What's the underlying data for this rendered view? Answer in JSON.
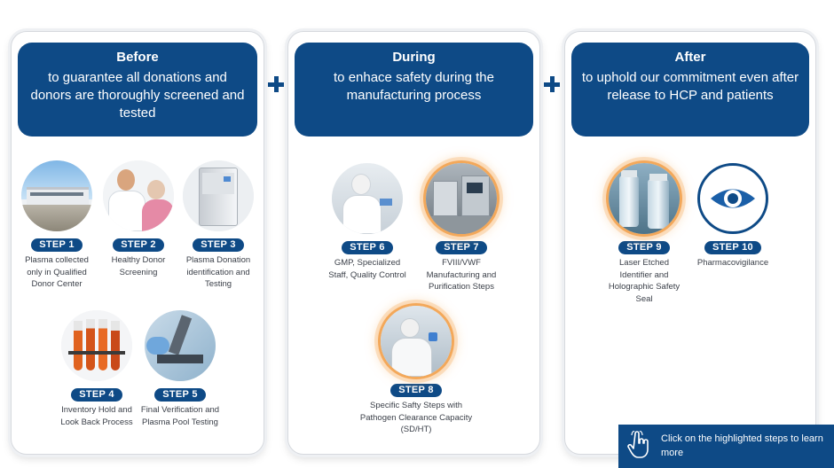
{
  "panels": {
    "before": {
      "title": "Before",
      "subtitle": "to guarantee all donations and donors are thoroughly screened and tested"
    },
    "during": {
      "title": "During",
      "subtitle": "to enhace safety during the manufacturing process"
    },
    "after": {
      "title": "After",
      "subtitle": "to uphold our commitment even after release to HCP and patients"
    }
  },
  "steps": [
    {
      "badge": "STEP 1",
      "label": "Plasma collected only in Qualified Donor Center",
      "highlighted": false
    },
    {
      "badge": "STEP 2",
      "label": "Healthy Donor Screening",
      "highlighted": false
    },
    {
      "badge": "STEP 3",
      "label": "Plasma Donation identification and Testing",
      "highlighted": false
    },
    {
      "badge": "STEP 4",
      "label": "Inventory Hold and Look Back Process",
      "highlighted": false
    },
    {
      "badge": "STEP 5",
      "label": "Final Verification and Plasma Pool Testing",
      "highlighted": false
    },
    {
      "badge": "STEP 6",
      "label": "GMP, Specialized Staff, Quality Control",
      "highlighted": false
    },
    {
      "badge": "STEP 7",
      "label": "FVIII/VWF Manufacturing and Purification Steps",
      "highlighted": true
    },
    {
      "badge": "STEP 8",
      "label": "Specific Safty Steps with Pathogen Clearance Capacity (SD/HT)",
      "highlighted": true
    },
    {
      "badge": "STEP 9",
      "label": "Laser Etched Identifier and Holographic Safety Seal",
      "highlighted": true
    },
    {
      "badge": "STEP 10",
      "label": "Pharmacovigilance",
      "highlighted": false
    }
  ],
  "cta": {
    "text": "Click on the highlighted steps to learn more",
    "icon": "hand-pointer-icon"
  },
  "colors": {
    "primary": "#0e4a86",
    "highlight": "#f3a85a"
  }
}
